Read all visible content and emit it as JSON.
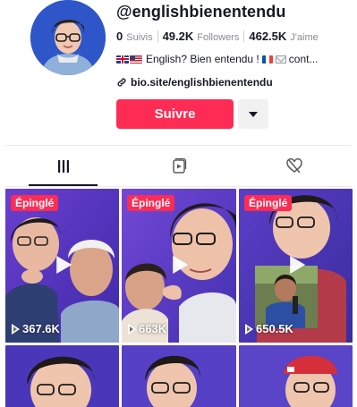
{
  "profile": {
    "username": "@englishbienentendu",
    "stats": [
      {
        "value": "0",
        "label": "Suivis"
      },
      {
        "value": "49.2K",
        "label": "Followers"
      },
      {
        "value": "462.5K",
        "label": "J'aime"
      }
    ],
    "bio_text_1": "English? Bien entendu !",
    "bio_text_2": "cont...",
    "bio_icons": [
      "uk-flag-icon",
      "us-flag-icon",
      "fr-flag-icon",
      "envelope-icon"
    ],
    "link_text": "bio.site/englishbienentendu",
    "follow_label": "Suivre",
    "avatar_color": "#2f56c9"
  },
  "tabs": [
    {
      "name": "videos",
      "icon": "grid-icon",
      "active": true
    },
    {
      "name": "reposts",
      "icon": "repost-icon",
      "active": false
    },
    {
      "name": "liked",
      "icon": "liked-hidden-icon",
      "active": false
    }
  ],
  "videos": [
    {
      "pinned_label": "Épinglé",
      "views": "367.6K"
    },
    {
      "pinned_label": "Épinglé",
      "views": "663K"
    },
    {
      "pinned_label": "Épinglé",
      "views": "650.5K"
    }
  ],
  "colors": {
    "accent": "#fe2c55",
    "text": "#161823",
    "muted": "#8a8b91"
  }
}
